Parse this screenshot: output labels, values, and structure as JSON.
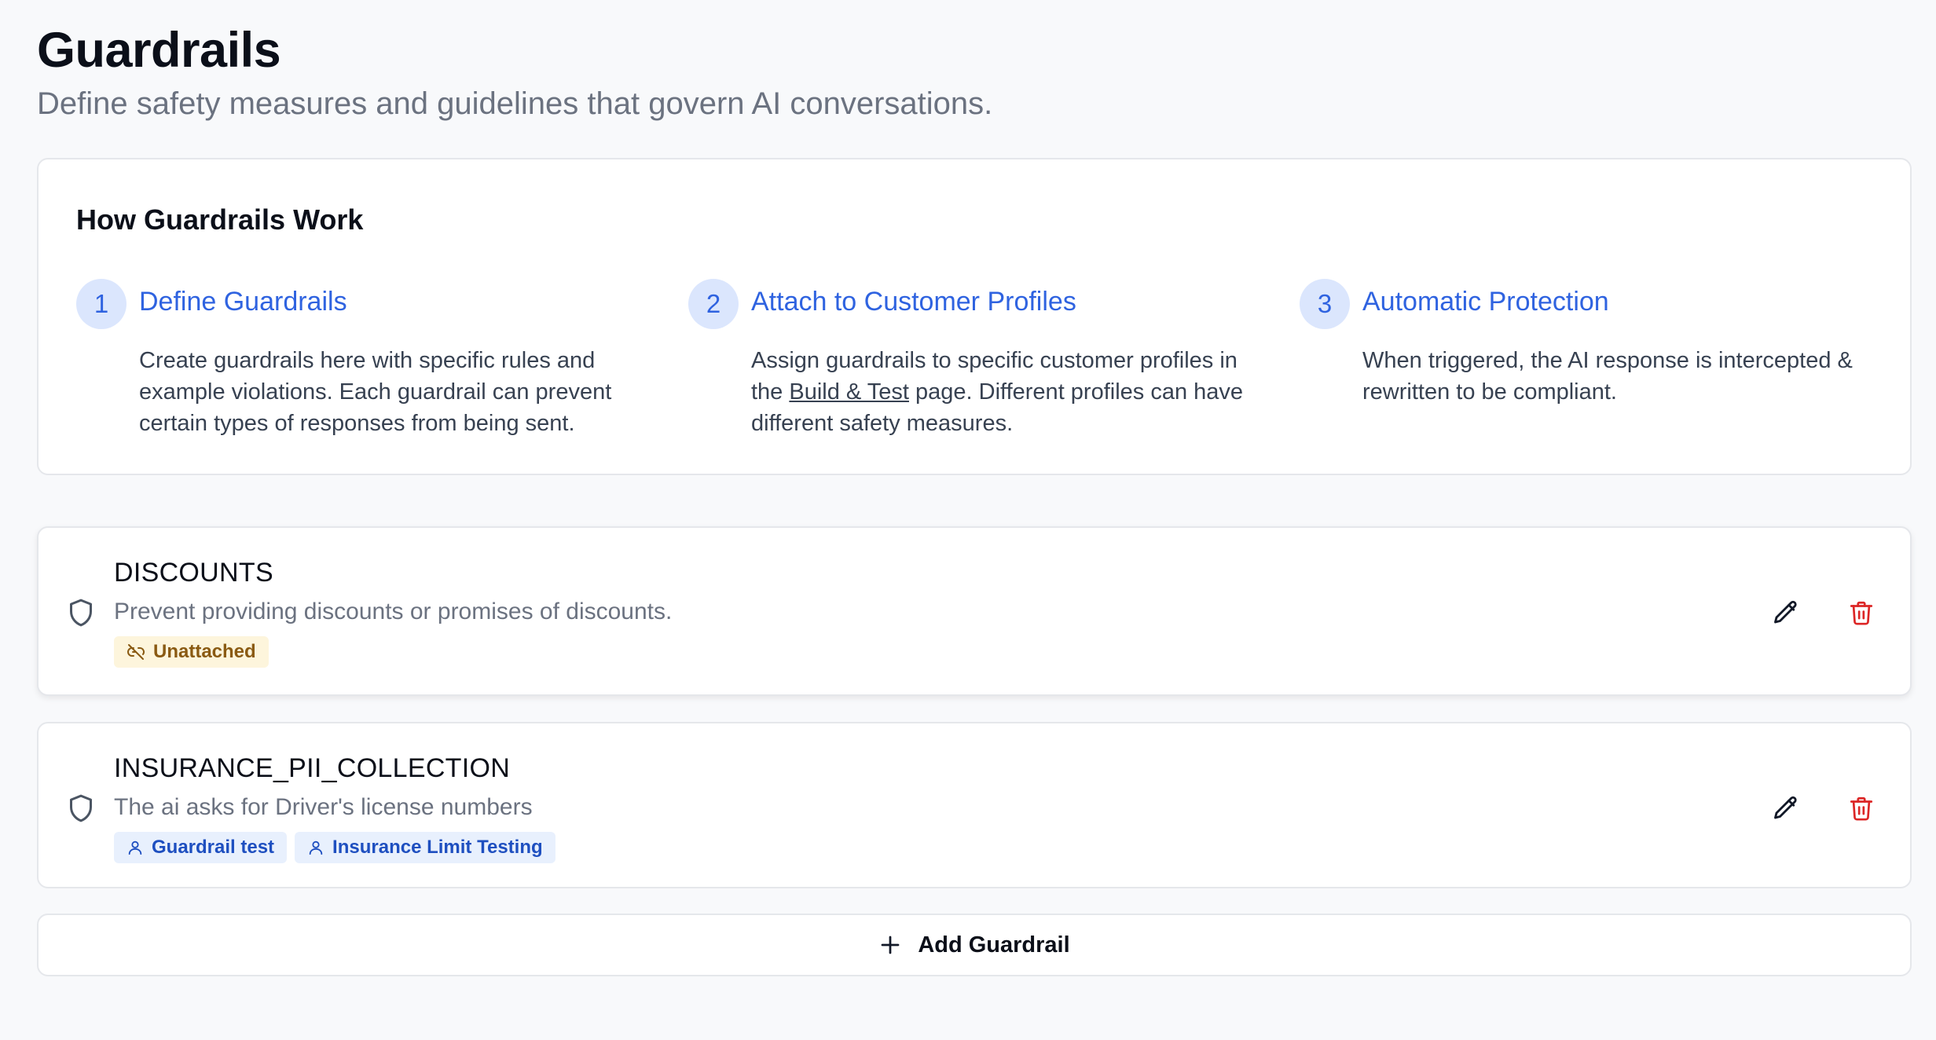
{
  "page": {
    "title": "Guardrails",
    "subtitle": "Define safety measures and guidelines that govern AI conversations."
  },
  "how_it_works": {
    "title": "How Guardrails Work",
    "steps": [
      {
        "number": "1",
        "title": "Define Guardrails",
        "description": "Create guardrails here with specific rules and example violations. Each guardrail can prevent certain types of responses from being sent."
      },
      {
        "number": "2",
        "title": "Attach to Customer Profiles",
        "description_before": "Assign guardrails to specific customer profiles in the ",
        "link_text": "Build & Test",
        "description_after": " page. Different profiles can have different safety measures."
      },
      {
        "number": "3",
        "title": "Automatic Protection",
        "description": "When triggered, the AI response is intercepted & rewritten to be compliant."
      }
    ]
  },
  "guardrails": [
    {
      "name": "DISCOUNTS",
      "description": "Prevent providing discounts or promises of discounts.",
      "status_tag": "Unattached",
      "profiles": []
    },
    {
      "name": "INSURANCE_PII_COLLECTION",
      "description": "The ai asks for Driver's license numbers",
      "profiles": [
        "Guardrail test",
        "Insurance Limit Testing"
      ]
    }
  ],
  "add_button": {
    "label": "Add Guardrail"
  },
  "icons": {
    "shield": "shield-icon",
    "edit": "pencil-icon",
    "delete": "trash-icon",
    "unlink": "unlink-icon",
    "user": "user-icon",
    "add": "plus-icon"
  },
  "colors": {
    "accent": "#2f63e0",
    "danger": "#dc2626",
    "unattached_bg": "#fdf5dc",
    "unattached_text": "#8a5a12",
    "profile_bg": "#e8f0fd",
    "profile_text": "#1e4fc0"
  }
}
